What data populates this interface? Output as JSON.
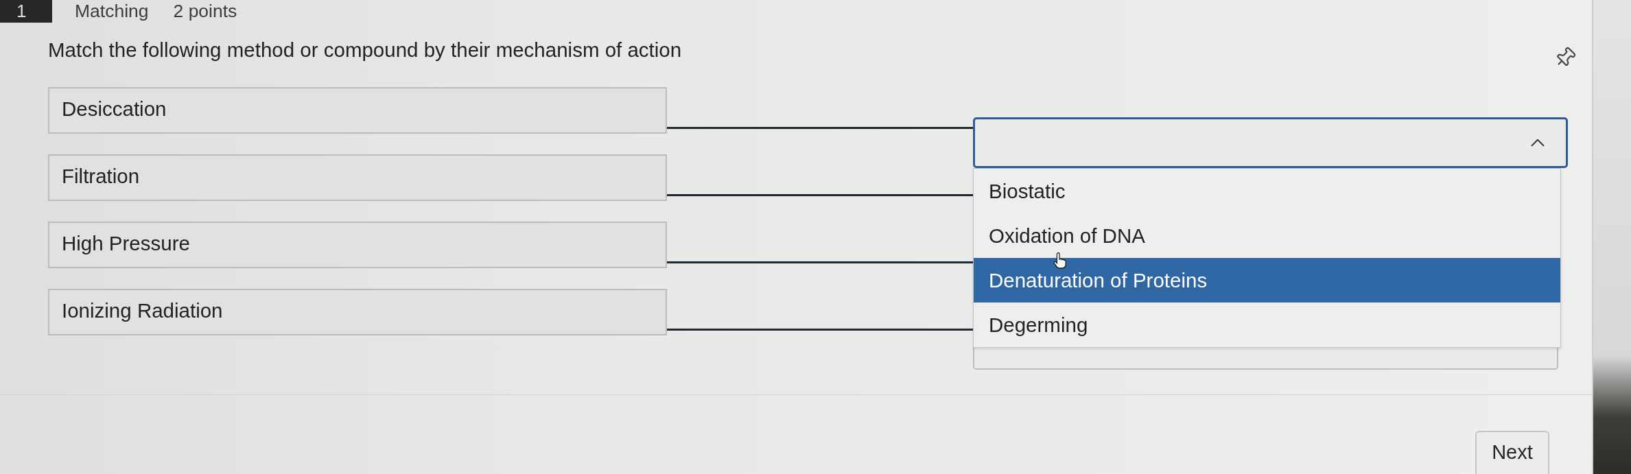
{
  "header": {
    "number": "1",
    "type": "Matching",
    "points": "2 points"
  },
  "question": {
    "prompt": "Match the following method or compound by their mechanism of action"
  },
  "matches": [
    {
      "item": "Desiccation",
      "expanded": true
    },
    {
      "item": "Filtration",
      "expanded": false
    },
    {
      "item": "High Pressure",
      "expanded": false
    },
    {
      "item": "Ionizing Radiation",
      "expanded": false
    }
  ],
  "dropdown_options": [
    {
      "label": "Biostatic",
      "selected": false
    },
    {
      "label": "Oxidation of DNA",
      "selected": false
    },
    {
      "label": "Denaturation of Proteins",
      "selected": true
    },
    {
      "label": "Degerming",
      "selected": false
    }
  ],
  "footer": {
    "next_button": "Next"
  }
}
